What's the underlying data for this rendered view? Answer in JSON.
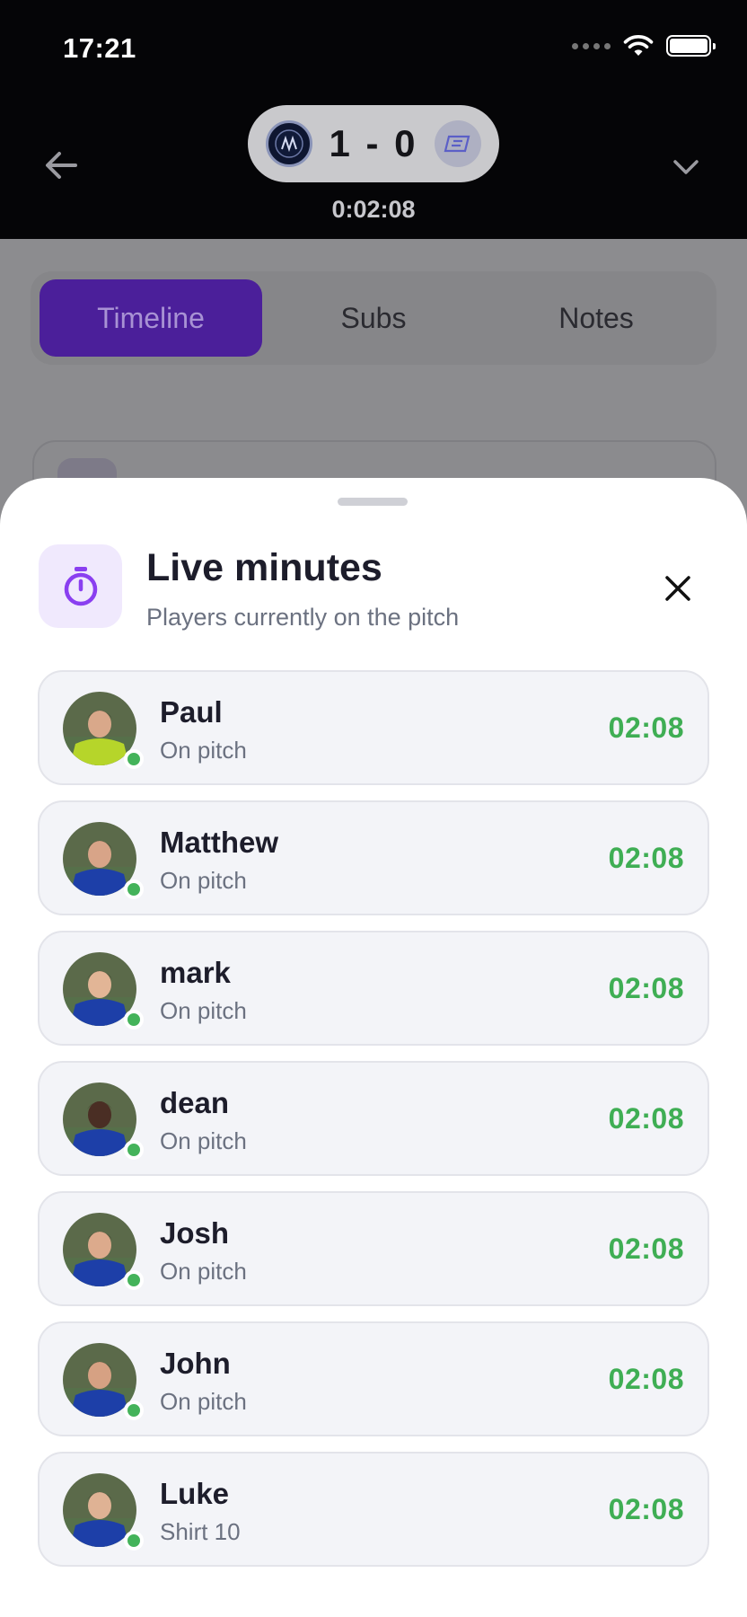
{
  "status_bar": {
    "time": "17:21"
  },
  "header": {
    "home_score": "1",
    "separator": "-",
    "away_score": "0",
    "match_clock": "0:02:08"
  },
  "tabs": [
    {
      "label": "Timeline",
      "active": true
    },
    {
      "label": "Subs",
      "active": false
    },
    {
      "label": "Notes",
      "active": false
    }
  ],
  "sheet": {
    "title": "Live minutes",
    "subtitle": "Players currently on the pitch",
    "icon": "stopwatch-icon"
  },
  "players": [
    {
      "name": "Paul",
      "status": "On pitch",
      "minutes": "02:08",
      "kit": "#b6d52a",
      "skin": "#d9a88a"
    },
    {
      "name": "Matthew",
      "status": "On pitch",
      "minutes": "02:08",
      "kit": "#1d3fa8",
      "skin": "#d8a488"
    },
    {
      "name": "mark",
      "status": "On pitch",
      "minutes": "02:08",
      "kit": "#1d3fa8",
      "skin": "#e2b596"
    },
    {
      "name": "dean",
      "status": "On pitch",
      "minutes": "02:08",
      "kit": "#1d3fa8",
      "skin": "#4a2e24"
    },
    {
      "name": "Josh",
      "status": "On pitch",
      "minutes": "02:08",
      "kit": "#1d3fa8",
      "skin": "#dcaa8c"
    },
    {
      "name": "John",
      "status": "On pitch",
      "minutes": "02:08",
      "kit": "#1d3fa8",
      "skin": "#d6a183"
    },
    {
      "name": "Luke",
      "status": "Shirt 10",
      "minutes": "02:08",
      "kit": "#1d3fa8",
      "skin": "#dfb294"
    }
  ],
  "colors": {
    "accent": "#7b3fe4",
    "online": "#44b35a",
    "minutes": "#3fae54"
  }
}
